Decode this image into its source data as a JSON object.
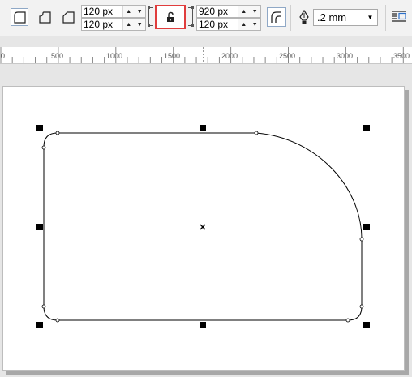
{
  "toolbar": {
    "corner_tools": [
      {
        "name": "round-corner-button",
        "icon": "round-corner-icon",
        "selected": true
      },
      {
        "name": "scalloped-corner-button",
        "icon": "scalloped-corner-icon",
        "selected": false
      },
      {
        "name": "chamfered-corner-button",
        "icon": "chamfered-corner-icon",
        "selected": false
      }
    ],
    "corner_radius": {
      "top_left": "120 px",
      "bottom_left": "120 px",
      "top_right": "920 px",
      "bottom_right": "120 px"
    },
    "lock_icon": "padlock-unlocked-icon",
    "relative_scaling_icon": "relative-corner-scaling-icon",
    "outline_pen_icon": "pen-nib-icon",
    "outline_width": ".2 mm",
    "text_wrap_icon": "wrap-text-icon"
  },
  "ruler": {
    "labels": [
      "0",
      "500",
      "1000",
      "1500",
      "2000",
      "2500",
      "3000",
      "3500"
    ]
  },
  "canvas": {
    "shape": "rounded-rectangle",
    "highlight_color": "#e03c3c"
  }
}
